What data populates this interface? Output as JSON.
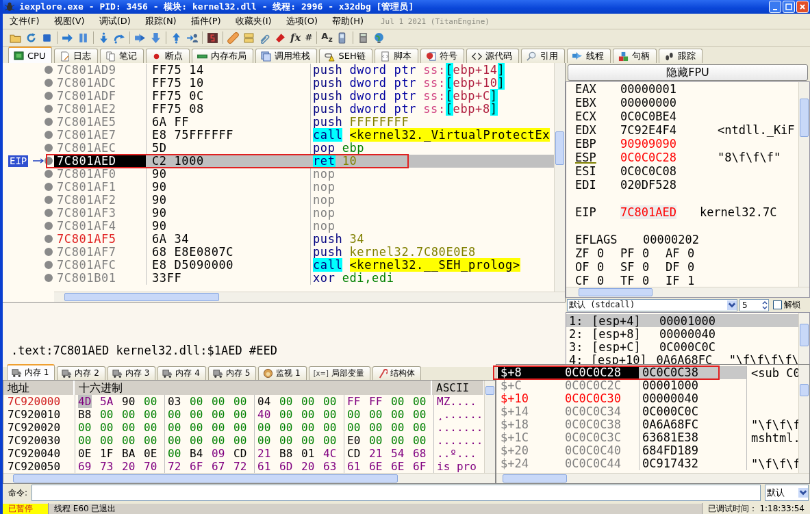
{
  "window": {
    "title": "iexplore.exe - PID: 3456 - 模块: kernel32.dll - 线程: 2996 - x32dbg [管理员]"
  },
  "menu": [
    "文件(F)",
    "视图(V)",
    "调试(D)",
    "跟踪(N)",
    "插件(P)",
    "收藏夹(I)",
    "选项(O)",
    "帮助(H)"
  ],
  "build_info": "Jul 1 2021 (TitanEngine)",
  "toolbar_glyphs": [
    "fx",
    "#",
    "A$_{z}$"
  ],
  "tabs": [
    {
      "label": "CPU",
      "selected": true
    },
    {
      "label": "日志",
      "selected": false
    },
    {
      "label": "笔记",
      "selected": false
    },
    {
      "label": "断点",
      "selected": false
    },
    {
      "label": "内存布局",
      "selected": false
    },
    {
      "label": "调用堆栈",
      "selected": false
    },
    {
      "label": "SEH链",
      "selected": false
    },
    {
      "label": "脚本",
      "selected": false
    },
    {
      "label": "符号",
      "selected": false
    },
    {
      "label": "源代码",
      "selected": false
    },
    {
      "label": "引用",
      "selected": false
    },
    {
      "label": "线程",
      "selected": false
    },
    {
      "label": "句柄",
      "selected": false
    },
    {
      "label": "跟踪",
      "selected": false
    }
  ],
  "disassembly": {
    "eip_label": "EIP",
    "rows": [
      {
        "address": "7C801AD9",
        "bytes": "FF75 14",
        "selected": false,
        "eip": false,
        "flagged": false,
        "instruction": [
          {
            "text": "push",
            "kind": "mnemonic"
          },
          {
            "text": "dword ptr",
            "kind": "size"
          },
          {
            "text": "ss:",
            "kind": "segment"
          },
          {
            "text": "[",
            "kind": "bracket"
          },
          {
            "text": "ebp+14",
            "kind": "memory"
          },
          {
            "text": "]",
            "kind": "bracket"
          }
        ]
      },
      {
        "address": "7C801ADC",
        "bytes": "FF75 10",
        "selected": false,
        "eip": false,
        "flagged": false,
        "instruction": [
          {
            "text": "push",
            "kind": "mnemonic"
          },
          {
            "text": "dword ptr",
            "kind": "size"
          },
          {
            "text": "ss:",
            "kind": "segment"
          },
          {
            "text": "[",
            "kind": "bracket"
          },
          {
            "text": "ebp+10",
            "kind": "memory"
          },
          {
            "text": "]",
            "kind": "bracket"
          }
        ]
      },
      {
        "address": "7C801ADF",
        "bytes": "FF75 0C",
        "selected": false,
        "eip": false,
        "flagged": false,
        "instruction": [
          {
            "text": "push",
            "kind": "mnemonic"
          },
          {
            "text": "dword ptr",
            "kind": "size"
          },
          {
            "text": "ss:",
            "kind": "segment"
          },
          {
            "text": "[",
            "kind": "bracket"
          },
          {
            "text": "ebp+C",
            "kind": "memory"
          },
          {
            "text": "]",
            "kind": "bracket"
          }
        ]
      },
      {
        "address": "7C801AE2",
        "bytes": "FF75 08",
        "selected": false,
        "eip": false,
        "flagged": false,
        "instruction": [
          {
            "text": "push",
            "kind": "mnemonic"
          },
          {
            "text": "dword ptr",
            "kind": "size"
          },
          {
            "text": "ss:",
            "kind": "segment"
          },
          {
            "text": "[",
            "kind": "bracket"
          },
          {
            "text": "ebp+8",
            "kind": "memory"
          },
          {
            "text": "]",
            "kind": "bracket"
          }
        ]
      },
      {
        "address": "7C801AE5",
        "bytes": "6A FF",
        "selected": false,
        "eip": false,
        "flagged": false,
        "instruction": [
          {
            "text": "push",
            "kind": "mnemonic"
          },
          {
            "text": "FFFFFFFF",
            "kind": "number"
          }
        ]
      },
      {
        "address": "7C801AE7",
        "bytes": "E8 75FFFFFF",
        "selected": false,
        "eip": false,
        "flagged": false,
        "instruction": [
          {
            "text": "call",
            "kind": "call"
          },
          {
            "text": "<kernel32._VirtualProtectEx",
            "kind": "target"
          }
        ]
      },
      {
        "address": "7C801AEC",
        "bytes": "5D",
        "selected": false,
        "eip": false,
        "flagged": false,
        "instruction": [
          {
            "text": "pop",
            "kind": "mnemonic"
          },
          {
            "text": "ebp",
            "kind": "register"
          }
        ]
      },
      {
        "address": "7C801AED",
        "bytes": "C2 1000",
        "selected": true,
        "eip": true,
        "flagged": false,
        "instruction": [
          {
            "text": "ret",
            "kind": "call"
          },
          {
            "text": "10",
            "kind": "number"
          }
        ]
      },
      {
        "address": "7C801AF0",
        "bytes": "90",
        "selected": false,
        "eip": false,
        "flagged": false,
        "instruction": [
          {
            "text": "nop",
            "kind": "nop"
          }
        ]
      },
      {
        "address": "7C801AF1",
        "bytes": "90",
        "selected": false,
        "eip": false,
        "flagged": false,
        "instruction": [
          {
            "text": "nop",
            "kind": "nop"
          }
        ]
      },
      {
        "address": "7C801AF2",
        "bytes": "90",
        "selected": false,
        "eip": false,
        "flagged": false,
        "instruction": [
          {
            "text": "nop",
            "kind": "nop"
          }
        ]
      },
      {
        "address": "7C801AF3",
        "bytes": "90",
        "selected": false,
        "eip": false,
        "flagged": false,
        "instruction": [
          {
            "text": "nop",
            "kind": "nop"
          }
        ]
      },
      {
        "address": "7C801AF4",
        "bytes": "90",
        "selected": false,
        "eip": false,
        "flagged": false,
        "instruction": [
          {
            "text": "nop",
            "kind": "nop"
          }
        ]
      },
      {
        "address": "7C801AF5",
        "bytes": "6A 34",
        "selected": false,
        "eip": false,
        "flagged": true,
        "instruction": [
          {
            "text": "push",
            "kind": "mnemonic"
          },
          {
            "text": "34",
            "kind": "number"
          }
        ]
      },
      {
        "address": "7C801AF7",
        "bytes": "68 E8E0807C",
        "selected": false,
        "eip": false,
        "flagged": false,
        "instruction": [
          {
            "text": "push",
            "kind": "mnemonic"
          },
          {
            "text": "kernel32.7C80E0E8",
            "kind": "number"
          }
        ]
      },
      {
        "address": "7C801AFC",
        "bytes": "E8 D5090000",
        "selected": false,
        "eip": false,
        "flagged": false,
        "instruction": [
          {
            "text": "call",
            "kind": "call"
          },
          {
            "text": "<kernel32.__SEH_prolog>",
            "kind": "target"
          }
        ]
      },
      {
        "address": "7C801B01",
        "bytes": "33FF",
        "selected": false,
        "eip": false,
        "flagged": false,
        "instruction": [
          {
            "text": "xor",
            "kind": "mnemonic"
          },
          {
            "text": "edi,edi",
            "kind": "register"
          }
        ]
      }
    ]
  },
  "info_line": ".text:7C801AED kernel32.dll:$1AED #EED",
  "registers": {
    "fpu_button": "隐藏FPU",
    "general": [
      {
        "name": "EAX",
        "value": "00000001",
        "changed": false
      },
      {
        "name": "EBX",
        "value": "00000000",
        "changed": false
      },
      {
        "name": "ECX",
        "value": "0C0C0BE4",
        "changed": false
      },
      {
        "name": "EDX",
        "value": "7C92E4F4",
        "comment": "<ntdll._KiF",
        "changed": false
      },
      {
        "name": "EBP",
        "value": "90909090",
        "changed": true
      },
      {
        "name": "ESP",
        "value": "0C0C0C28",
        "comment": "\"8\\f\\f\\f\"",
        "changed": true
      },
      {
        "name": "ESI",
        "value": "0C0C0C08",
        "changed": false
      },
      {
        "name": "EDI",
        "value": "020DF528",
        "changed": false
      }
    ],
    "eip": {
      "name": "EIP",
      "value": "7C801AED",
      "comment": "kernel32.7C",
      "changed": true
    },
    "eflags": {
      "name": "EFLAGS",
      "value": "00000202"
    },
    "flags": [
      [
        {
          "name": "ZF",
          "value": "0"
        },
        {
          "name": "PF",
          "value": "0"
        },
        {
          "name": "AF",
          "value": "0"
        }
      ],
      [
        {
          "name": "OF",
          "value": "0"
        },
        {
          "name": "SF",
          "value": "0"
        },
        {
          "name": "DF",
          "value": "0"
        }
      ],
      [
        {
          "name": "CF",
          "value": "0"
        },
        {
          "name": "TF",
          "value": "0"
        },
        {
          "name": "IF",
          "value": "1"
        }
      ]
    ]
  },
  "arguments": {
    "convention": "默认 (stdcall)",
    "count": "5",
    "unlock": {
      "label": "解锁",
      "checked": false
    },
    "rows": [
      {
        "index": "1:",
        "location": "[esp+4]",
        "value": "00001000",
        "selected": true
      },
      {
        "index": "2:",
        "location": "[esp+8]",
        "value": "00000040",
        "selected": false
      },
      {
        "index": "3:",
        "location": "[esp+C]",
        "value": "0C000C0C",
        "selected": false
      },
      {
        "index": "4:",
        "location": "[esp+10]",
        "value": "0A6A68FC",
        "comment": "\"\\f\\f\\f\\f\\",
        "selected": false
      }
    ]
  },
  "memory_tabs": [
    {
      "label": "内存 1",
      "selected": true
    },
    {
      "label": "内存 2",
      "selected": false
    },
    {
      "label": "内存 3",
      "selected": false
    },
    {
      "label": "内存 4",
      "selected": false
    },
    {
      "label": "内存 5",
      "selected": false
    },
    {
      "label": "监视 1",
      "selected": false
    },
    {
      "label": "局部变量",
      "glyph": "[x=]",
      "selected": false
    },
    {
      "label": "结构体",
      "selected": false
    }
  ],
  "dump": {
    "columns": [
      "地址",
      "十六进制",
      "ASCII"
    ],
    "rows": [
      {
        "address": "7C920000",
        "bytes": [
          "4D",
          "5A",
          "90",
          "00",
          "03",
          "00",
          "00",
          "00",
          "04",
          "00",
          "00",
          "00",
          "FF",
          "FF",
          "00",
          "00"
        ],
        "ascii": "MZ....",
        "selected": true
      },
      {
        "address": "7C920010",
        "bytes": [
          "B8",
          "00",
          "00",
          "00",
          "00",
          "00",
          "00",
          "00",
          "40",
          "00",
          "00",
          "00",
          "00",
          "00",
          "00",
          "00"
        ],
        "ascii": "¸......",
        "selected": false
      },
      {
        "address": "7C920020",
        "bytes": [
          "00",
          "00",
          "00",
          "00",
          "00",
          "00",
          "00",
          "00",
          "00",
          "00",
          "00",
          "00",
          "00",
          "00",
          "00",
          "00"
        ],
        "ascii": ".......",
        "selected": false
      },
      {
        "address": "7C920030",
        "bytes": [
          "00",
          "00",
          "00",
          "00",
          "00",
          "00",
          "00",
          "00",
          "00",
          "00",
          "00",
          "00",
          "E0",
          "00",
          "00",
          "00"
        ],
        "ascii": ".......",
        "selected": false
      },
      {
        "address": "7C920040",
        "bytes": [
          "0E",
          "1F",
          "BA",
          "0E",
          "00",
          "B4",
          "09",
          "CD",
          "21",
          "B8",
          "01",
          "4C",
          "CD",
          "21",
          "54",
          "68"
        ],
        "ascii": "..º...",
        "selected": false
      },
      {
        "address": "7C920050",
        "bytes": [
          "69",
          "73",
          "20",
          "70",
          "72",
          "6F",
          "67",
          "72",
          "61",
          "6D",
          "20",
          "63",
          "61",
          "6E",
          "6E",
          "6F"
        ],
        "ascii": "is pro",
        "selected": false
      }
    ]
  },
  "stack": {
    "rows": [
      {
        "offset": "$+8",
        "address": "0C0C0C28",
        "value": "0C0C0C38",
        "comment": "<sub_C0",
        "selected": true,
        "flagged": false
      },
      {
        "offset": "$+C",
        "address": "0C0C0C2C",
        "value": "00001000",
        "selected": false,
        "flagged": false
      },
      {
        "offset": "$+10",
        "address": "0C0C0C30",
        "value": "00000040",
        "selected": false,
        "flagged": true
      },
      {
        "offset": "$+14",
        "address": "0C0C0C34",
        "value": "0C000C0C",
        "selected": false,
        "flagged": false
      },
      {
        "offset": "$+18",
        "address": "0C0C0C38",
        "value": "0A6A68FC",
        "comment": "\"\\f\\f\\f",
        "selected": false,
        "flagged": false
      },
      {
        "offset": "$+1C",
        "address": "0C0C0C3C",
        "value": "63681E38",
        "comment": "mshtml.",
        "selected": false,
        "flagged": false
      },
      {
        "offset": "$+20",
        "address": "0C0C0C40",
        "value": "684FD189",
        "selected": false,
        "flagged": false
      },
      {
        "offset": "$+24",
        "address": "0C0C0C44",
        "value": "0C917432",
        "comment": "\"\\f\\f\\f",
        "selected": false,
        "flagged": false
      }
    ]
  },
  "command": {
    "label": "命令:",
    "mode": "默认"
  },
  "status_bar": {
    "state": "已暂停",
    "message": "线程 E60 已退出",
    "elapsed": "已调试时间： 1:18:33:54"
  }
}
